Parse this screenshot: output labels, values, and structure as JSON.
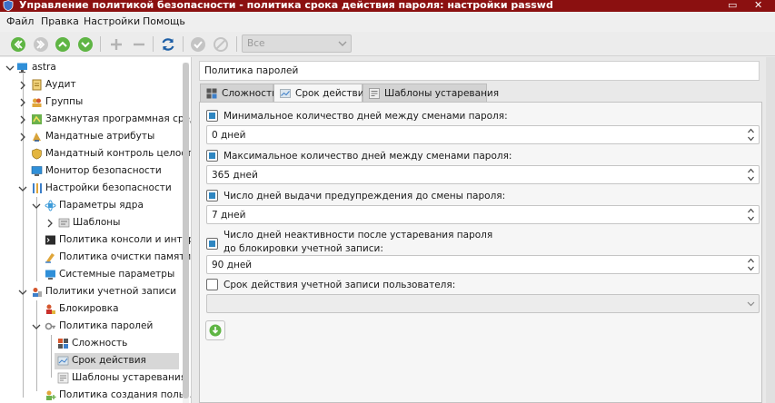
{
  "window": {
    "title": "Управление политикой безопасности - политика срока действия пароля: настройки passwd",
    "close_glyph": "✕",
    "restore_glyph": "▭"
  },
  "menu": [
    "Файл",
    "Правка",
    "Настройки",
    "Помощь"
  ],
  "toolbar": {
    "filter_value": "Все",
    "icons": [
      "back-icon",
      "forward-icon",
      "up-icon",
      "down-icon",
      "add-icon",
      "remove-icon",
      "refresh-icon",
      "apply-icon",
      "cancel-icon"
    ]
  },
  "tree": {
    "items": [
      {
        "label": "astra",
        "icon": "monitor-icon"
      },
      {
        "label": "Аудит",
        "icon": "audit-icon"
      },
      {
        "label": "Группы",
        "icon": "groups-icon"
      },
      {
        "label": "Замкнутая программная среда",
        "icon": "closed-env-icon"
      },
      {
        "label": "Мандатные атрибуты",
        "icon": "mandatory-attrs-icon"
      },
      {
        "label": "Мандатный контроль целост...",
        "icon": "integrity-icon"
      },
      {
        "label": "Монитор безопасности",
        "icon": "security-monitor-icon"
      },
      {
        "label": "Настройки безопасности",
        "icon": "settings-icon"
      },
      {
        "label": "Параметры ядра",
        "icon": "kernel-icon"
      },
      {
        "label": "Шаблоны",
        "icon": "templates-icon"
      },
      {
        "label": "Политика консоли и интер...",
        "icon": "console-icon"
      },
      {
        "label": "Политика очистки памяти",
        "icon": "memory-icon"
      },
      {
        "label": "Системные параметры",
        "icon": "system-params-icon"
      },
      {
        "label": "Политики учетной записи",
        "icon": "accounts-icon"
      },
      {
        "label": "Блокировка",
        "icon": "lock-icon"
      },
      {
        "label": "Политика паролей",
        "icon": "password-policy-icon"
      },
      {
        "label": "Сложность",
        "icon": "complexity-icon"
      },
      {
        "label": "Срок действия",
        "icon": "expiry-icon"
      },
      {
        "label": "Шаблоны устаревания",
        "icon": "aging-templates-icon"
      },
      {
        "label": "Политика создания польз...",
        "icon": "user-creation-icon"
      }
    ]
  },
  "panel": {
    "heading": "Политика паролей",
    "tabs": [
      {
        "label": "Сложность"
      },
      {
        "label": "Срок действия"
      },
      {
        "label": "Шаблоны устаревания"
      }
    ],
    "fields": [
      {
        "label": "Минимальное количество дней между сменами пароля:",
        "value": "0 дней",
        "checked": true
      },
      {
        "label": "Максимальное количество дней между сменами пароля:",
        "value": "365 дней",
        "checked": true
      },
      {
        "label": "Число дней выдачи предупреждения до смены пароля:",
        "value": "7 дней",
        "checked": true
      },
      {
        "label_line1": "Число дней неактивности после устаревания пароля",
        "label_line2": "до блокировки учетной записи:",
        "value": "90 дней",
        "checked": true
      },
      {
        "label": "Срок действия учетной записи пользователя:",
        "value": "",
        "checked": false
      }
    ]
  },
  "colors": {
    "titlebar": "#8b1010",
    "checkbox_accent": "#2e86c1",
    "nav_green": "#4caf50"
  }
}
